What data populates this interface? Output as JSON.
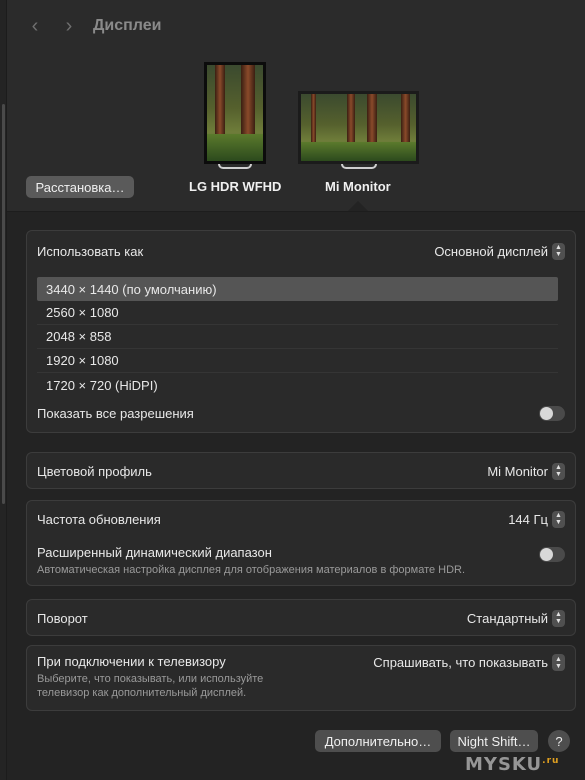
{
  "header": {
    "title": "Дисплеи",
    "back_icon": "‹",
    "forward_icon": "›"
  },
  "monitors": {
    "arrange_label": "Расстановка…",
    "displays": [
      {
        "name": "LG HDR WFHD"
      },
      {
        "name": "Mi Monitor"
      }
    ]
  },
  "use_as": {
    "label": "Использовать как",
    "value": "Основной дисплей"
  },
  "resolutions": {
    "items": [
      "3440 × 1440 (по умолчанию)",
      "2560 × 1080",
      "2048 × 858",
      "1920 × 1080",
      "1720 × 720 (HiDPI)"
    ],
    "selected_index": 0,
    "show_all_label": "Показать все разрешения",
    "show_all_on": false
  },
  "color_profile": {
    "label": "Цветовой профиль",
    "value": "Mi Monitor"
  },
  "refresh": {
    "label": "Частота обновления",
    "value": "144 Гц"
  },
  "hdr": {
    "label": "Расширенный динамический диапазон",
    "description": "Автоматическая настройка дисплея для отображения материалов в формате HDR.",
    "on": false
  },
  "rotation": {
    "label": "Поворот",
    "value": "Стандартный"
  },
  "tv": {
    "label": "При подключении к телевизору",
    "description_line1": "Выберите, что показывать, или используйте",
    "description_line2": "телевизор как дополнительный дисплей.",
    "value": "Спрашивать, что показывать"
  },
  "footer": {
    "advanced_label": "Дополнительно…",
    "night_shift_label": "Night Shift…",
    "help_label": "?"
  },
  "watermark": {
    "text": "MYSKU",
    "suffix": ".ru"
  },
  "colors": {
    "background": "#2b2b2b",
    "panel": "#2a2a2a",
    "selected_row": "#555555"
  }
}
